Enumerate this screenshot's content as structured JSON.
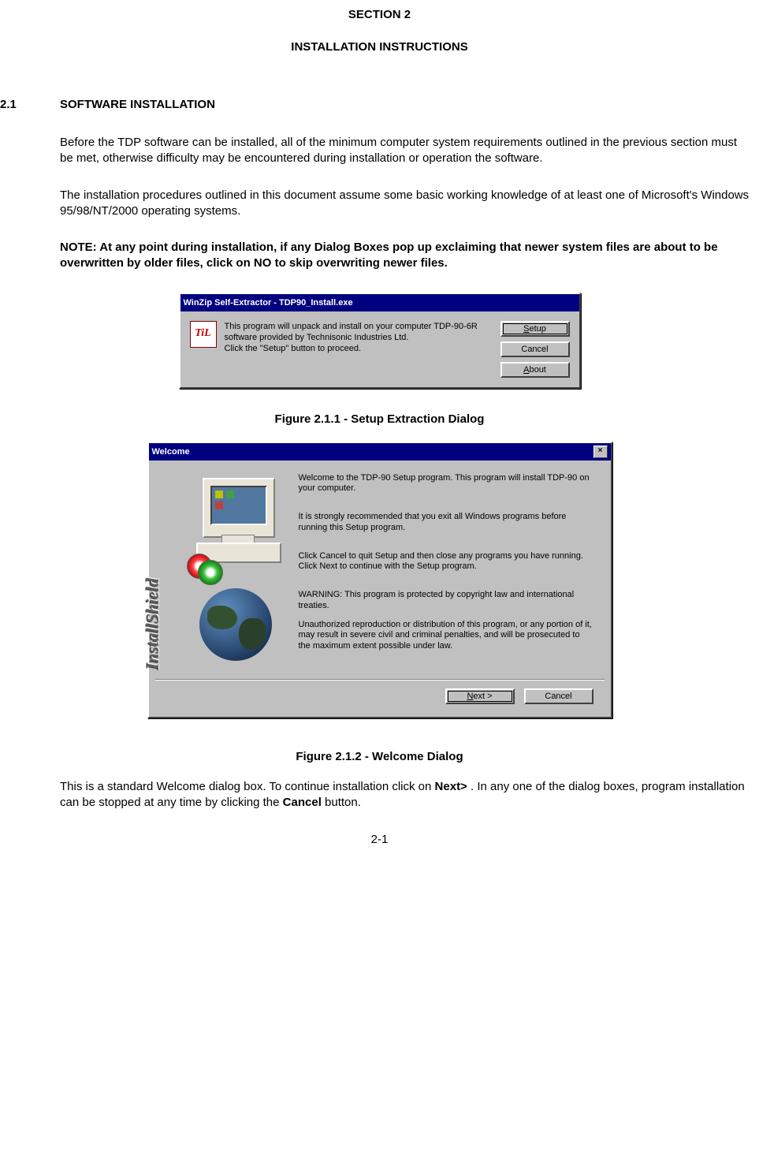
{
  "doc": {
    "section_header": "SECTION 2",
    "section_title": "INSTALLATION INSTRUCTIONS",
    "heading_num": "2.1",
    "heading_text": "SOFTWARE INSTALLATION",
    "para1": "Before the TDP software can be installed, all of the minimum computer system requirements outlined in the previous section must be met, otherwise difficulty may be encountered during installation or operation the software.",
    "para2": "The installation procedures outlined in this document assume some basic working knowledge of at least one of Microsoft's Windows 95/98/NT/2000 operating systems.",
    "note": "NOTE: At any point during installation, if any Dialog Boxes pop up exclaiming that newer system files are about to be overwritten by older files, click on NO to skip overwriting newer files.",
    "caption1": "Figure 2.1.1  - Setup Extraction Dialog",
    "caption2": "Figure 2.1.2  -  Welcome Dialog",
    "closing_prefix": "This is a standard Welcome dialog box. To continue installation click on ",
    "closing_bold1": "Next>",
    "closing_mid": " . In any one of the dialog boxes, program installation can be stopped at any time by clicking the ",
    "closing_bold2": "Cancel",
    "closing_suffix": " button.",
    "page_number": "2-1"
  },
  "winzip": {
    "title": "WinZip Self-Extractor - TDP90_Install.exe",
    "icon_text": "TiL",
    "body_line1": "This program will unpack and install on your computer TDP-90-6R software provided by Technisonic Industries Ltd.",
    "body_line2": "Click the \"Setup\" button to proceed.",
    "btn_setup": "Setup",
    "btn_cancel": "Cancel",
    "btn_about": "About"
  },
  "welcome": {
    "title": "Welcome",
    "p1": "Welcome to the TDP-90 Setup program.  This program will install TDP-90 on your computer.",
    "p2": "It is strongly recommended that you exit all Windows programs before running this Setup program.",
    "p3": "Click Cancel to quit Setup and then close any programs you have running.  Click Next to continue with the Setup program.",
    "p4": "WARNING: This program is protected by copyright law and international treaties.",
    "p5": "Unauthorized reproduction or distribution of this program, or any portion of it, may result in severe civil and criminal penalties, and will be prosecuted to the maximum extent possible under law.",
    "btn_next": "Next >",
    "btn_cancel": "Cancel",
    "sidebar_label": "InstallShield"
  }
}
